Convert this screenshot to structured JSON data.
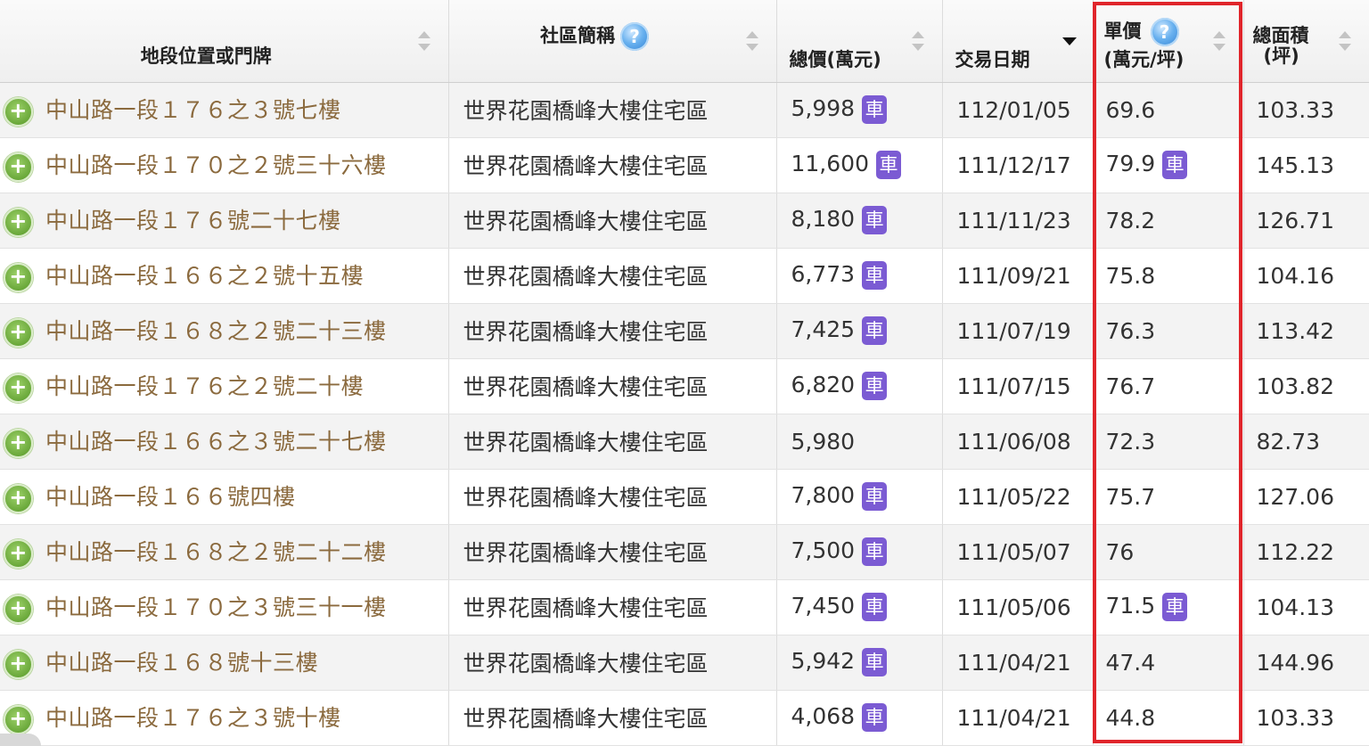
{
  "headers": {
    "address": "地段位置或門牌",
    "community": "社區簡稱",
    "total_price": "總價(萬元)",
    "trade_date": "交易日期",
    "unit_price_line1": "單價",
    "unit_price_line2": "(萬元/坪)",
    "area_line1": "總面積",
    "area_line2": "(坪)"
  },
  "icons": {
    "help": "question-mark-help-icon",
    "expand": "plus-circle-icon",
    "car_badge": "車",
    "sort": "sort-arrows-icon",
    "sort_active": "sort-descending-icon"
  },
  "colors": {
    "address_text": "#8b6a3e",
    "car_badge": "#7b5bd3",
    "highlight_border": "#e0252b",
    "expand_button": "#6aa83a"
  },
  "rows": [
    {
      "address": "中山路一段１７６之３號七樓",
      "community": "世界花園橋峰大樓住宅區",
      "total_price": "5,998",
      "total_price_car": true,
      "trade_date": "112/01/05",
      "unit_price": "69.6",
      "unit_price_car": false,
      "area": "103.33"
    },
    {
      "address": "中山路一段１７０之２號三十六樓",
      "community": "世界花園橋峰大樓住宅區",
      "total_price": "11,600",
      "total_price_car": true,
      "trade_date": "111/12/17",
      "unit_price": "79.9",
      "unit_price_car": true,
      "area": "145.13"
    },
    {
      "address": "中山路一段１７６號二十七樓",
      "community": "世界花園橋峰大樓住宅區",
      "total_price": "8,180",
      "total_price_car": true,
      "trade_date": "111/11/23",
      "unit_price": "78.2",
      "unit_price_car": false,
      "area": "126.71"
    },
    {
      "address": "中山路一段１６６之２號十五樓",
      "community": "世界花園橋峰大樓住宅區",
      "total_price": "6,773",
      "total_price_car": true,
      "trade_date": "111/09/21",
      "unit_price": "75.8",
      "unit_price_car": false,
      "area": "104.16"
    },
    {
      "address": "中山路一段１６８之２號二十三樓",
      "community": "世界花園橋峰大樓住宅區",
      "total_price": "7,425",
      "total_price_car": true,
      "trade_date": "111/07/19",
      "unit_price": "76.3",
      "unit_price_car": false,
      "area": "113.42"
    },
    {
      "address": "中山路一段１７６之２號二十樓",
      "community": "世界花園橋峰大樓住宅區",
      "total_price": "6,820",
      "total_price_car": true,
      "trade_date": "111/07/15",
      "unit_price": "76.7",
      "unit_price_car": false,
      "area": "103.82"
    },
    {
      "address": "中山路一段１６６之３號二十七樓",
      "community": "世界花園橋峰大樓住宅區",
      "total_price": "5,980",
      "total_price_car": false,
      "trade_date": "111/06/08",
      "unit_price": "72.3",
      "unit_price_car": false,
      "area": "82.73"
    },
    {
      "address": "中山路一段１６６號四樓",
      "community": "世界花園橋峰大樓住宅區",
      "total_price": "7,800",
      "total_price_car": true,
      "trade_date": "111/05/22",
      "unit_price": "75.7",
      "unit_price_car": false,
      "area": "127.06"
    },
    {
      "address": "中山路一段１６８之２號二十二樓",
      "community": "世界花園橋峰大樓住宅區",
      "total_price": "7,500",
      "total_price_car": true,
      "trade_date": "111/05/07",
      "unit_price": "76",
      "unit_price_car": false,
      "area": "112.22"
    },
    {
      "address": "中山路一段１７０之３號三十一樓",
      "community": "世界花園橋峰大樓住宅區",
      "total_price": "7,450",
      "total_price_car": true,
      "trade_date": "111/05/06",
      "unit_price": "71.5",
      "unit_price_car": true,
      "area": "104.13"
    },
    {
      "address": "中山路一段１６８號十三樓",
      "community": "世界花園橋峰大樓住宅區",
      "total_price": "5,942",
      "total_price_car": true,
      "trade_date": "111/04/21",
      "unit_price": "47.4",
      "unit_price_car": false,
      "area": "144.96"
    },
    {
      "address": "中山路一段１７６之３號十樓",
      "community": "世界花園橋峰大樓住宅區",
      "total_price": "4,068",
      "total_price_car": true,
      "trade_date": "111/04/21",
      "unit_price": "44.8",
      "unit_price_car": false,
      "area": "103.33"
    }
  ]
}
